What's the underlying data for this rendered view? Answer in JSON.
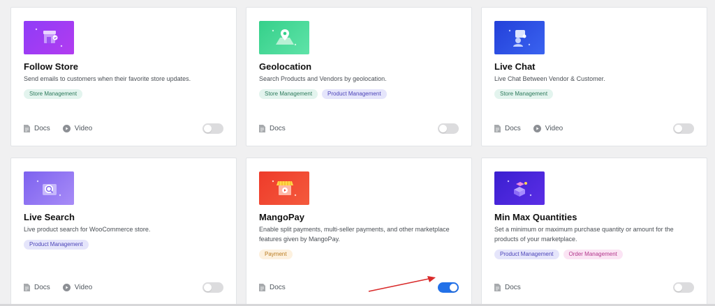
{
  "modules": [
    {
      "title": "Follow Store",
      "description": "Send emails to customers when their favorite store updates.",
      "tags": [
        {
          "label": "Store Management",
          "kind": "store"
        }
      ],
      "docs_label": "Docs",
      "video_label": "Video",
      "has_video": true,
      "enabled": false,
      "thumb_color": [
        "#8f3cf7",
        "#b23cf0"
      ],
      "icon": "storefront-icon"
    },
    {
      "title": "Geolocation",
      "description": "Search Products and Vendors by geolocation.",
      "tags": [
        {
          "label": "Store Management",
          "kind": "store"
        },
        {
          "label": "Product Management",
          "kind": "product"
        }
      ],
      "docs_label": "Docs",
      "has_video": false,
      "enabled": false,
      "thumb_color": [
        "#35d08a",
        "#5fe3a8"
      ],
      "icon": "map-pin-icon"
    },
    {
      "title": "Live Chat",
      "description": "Live Chat Between Vendor & Customer.",
      "tags": [
        {
          "label": "Store Management",
          "kind": "store"
        }
      ],
      "docs_label": "Docs",
      "video_label": "Video",
      "has_video": true,
      "enabled": false,
      "thumb_color": [
        "#2340d9",
        "#3a63f0"
      ],
      "icon": "chat-user-icon"
    },
    {
      "title": "Live Search",
      "description": "Live product search for WooCommerce store.",
      "tags": [
        {
          "label": "Product Management",
          "kind": "product"
        }
      ],
      "docs_label": "Docs",
      "video_label": "Video",
      "has_video": true,
      "enabled": false,
      "thumb_color": [
        "#7d62ef",
        "#a88cf7"
      ],
      "icon": "search-icon"
    },
    {
      "title": "MangoPay",
      "description": "Enable split payments, multi-seller payments, and other marketplace features given by MangoPay.",
      "tags": [
        {
          "label": "Payment",
          "kind": "payment"
        }
      ],
      "docs_label": "Docs",
      "has_video": false,
      "enabled": true,
      "thumb_color": [
        "#ee3b2a",
        "#f45a3d"
      ],
      "icon": "shop-payment-icon"
    },
    {
      "title": "Min Max Quantities",
      "description": "Set a minimum or maximum purchase quantity or amount for the products of your marketplace.",
      "tags": [
        {
          "label": "Product Management",
          "kind": "product"
        },
        {
          "label": "Order Management",
          "kind": "order"
        }
      ],
      "docs_label": "Docs",
      "has_video": false,
      "enabled": false,
      "thumb_color": [
        "#3a1fd0",
        "#5b2ee6"
      ],
      "icon": "boxes-icon"
    }
  ],
  "colors": {
    "toggle_on": "#2271e8",
    "toggle_off": "#dcdcde",
    "arrow": "#d92a2a"
  }
}
